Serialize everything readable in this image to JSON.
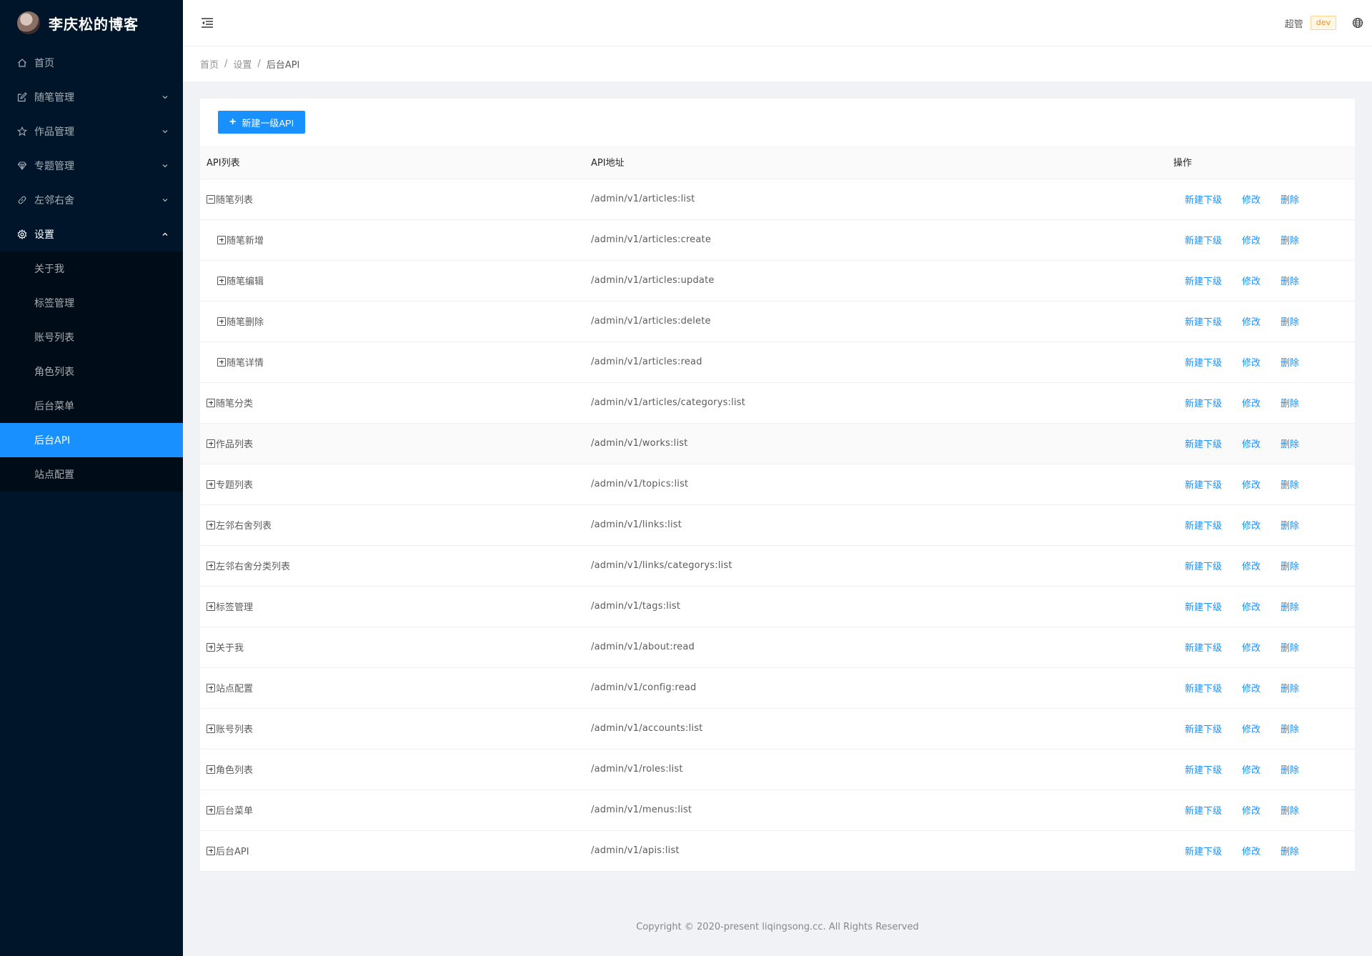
{
  "app": {
    "title": "李庆松的博客"
  },
  "sidebar": {
    "items": [
      {
        "label": "首页",
        "icon": "home-icon"
      },
      {
        "label": "随笔管理",
        "icon": "edit-icon"
      },
      {
        "label": "作品管理",
        "icon": "star-icon"
      },
      {
        "label": "专题管理",
        "icon": "diamond-icon"
      },
      {
        "label": "左邻右舍",
        "icon": "link-icon"
      },
      {
        "label": "设置",
        "icon": "gear-icon"
      }
    ],
    "settings_children": [
      {
        "label": "关于我"
      },
      {
        "label": "标签管理"
      },
      {
        "label": "账号列表"
      },
      {
        "label": "角色列表"
      },
      {
        "label": "后台菜单"
      },
      {
        "label": "后台API"
      },
      {
        "label": "站点配置"
      }
    ]
  },
  "header": {
    "user": "超管",
    "env_tag": "dev",
    "env_color": "#fa8c16"
  },
  "breadcrumb": [
    "首页",
    "设置",
    "后台API"
  ],
  "toolbar": {
    "new_button": "新建一级API"
  },
  "table": {
    "columns": [
      "API列表",
      "API地址",
      "操作"
    ],
    "ops": {
      "add_child": "新建下级",
      "edit": "修改",
      "delete": "删除"
    },
    "rows": [
      {
        "name": "随笔列表",
        "path": "/admin/v1/articles:list"
      },
      {
        "name": "随笔新增",
        "path": "/admin/v1/articles:create"
      },
      {
        "name": "随笔编辑",
        "path": "/admin/v1/articles:update"
      },
      {
        "name": "随笔删除",
        "path": "/admin/v1/articles:delete"
      },
      {
        "name": "随笔详情",
        "path": "/admin/v1/articles:read"
      },
      {
        "name": "随笔分类",
        "path": "/admin/v1/articles/categorys:list"
      },
      {
        "name": "作品列表",
        "path": "/admin/v1/works:list"
      },
      {
        "name": "专题列表",
        "path": "/admin/v1/topics:list"
      },
      {
        "name": "左邻右舍列表",
        "path": "/admin/v1/links:list"
      },
      {
        "name": "左邻右舍分类列表",
        "path": "/admin/v1/links/categorys:list"
      },
      {
        "name": "标签管理",
        "path": "/admin/v1/tags:list"
      },
      {
        "name": "关于我",
        "path": "/admin/v1/about:read"
      },
      {
        "name": "站点配置",
        "path": "/admin/v1/config:read"
      },
      {
        "name": "账号列表",
        "path": "/admin/v1/accounts:list"
      },
      {
        "name": "角色列表",
        "path": "/admin/v1/roles:list"
      },
      {
        "name": "后台菜单",
        "path": "/admin/v1/menus:list"
      },
      {
        "name": "后台API",
        "path": "/admin/v1/apis:list"
      }
    ]
  },
  "footer": {
    "text": "Copyright © 2020-present liqingsong.cc. All Rights Reserved"
  },
  "colors": {
    "sider_bg": "#001529",
    "primary": "#1890ff"
  }
}
